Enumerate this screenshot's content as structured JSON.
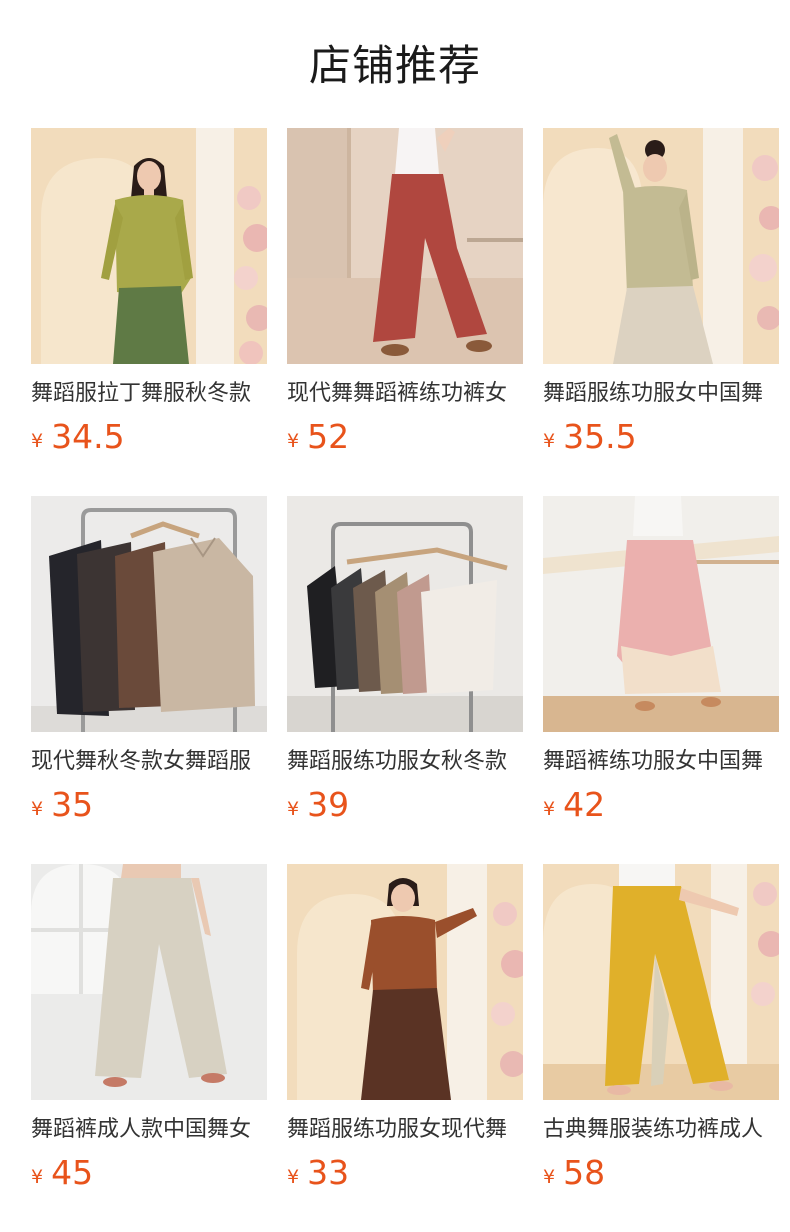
{
  "section": {
    "title": "店铺推荐"
  },
  "colors": {
    "price": "#e8531b",
    "text": "#333333"
  },
  "products": [
    {
      "name": "舞蹈服拉丁舞服秋冬款",
      "currency": "¥",
      "price": "34.5",
      "image": "olive-asymmetric-top-green-pants"
    },
    {
      "name": "现代舞舞蹈裤练功裤女",
      "currency": "¥",
      "price": "52",
      "image": "red-wide-leg-pants"
    },
    {
      "name": "舞蹈服练功服女中国舞",
      "currency": "¥",
      "price": "35.5",
      "image": "khaki-cardigan-beige-pants"
    },
    {
      "name": "现代舞秋冬款女舞蹈服",
      "currency": "¥",
      "price": "35",
      "image": "long-sleeve-tops-on-rack"
    },
    {
      "name": "舞蹈服练功服女秋冬款",
      "currency": "¥",
      "price": "39",
      "image": "camisoles-on-rack"
    },
    {
      "name": "舞蹈裤练功服女中国舞",
      "currency": "¥",
      "price": "42",
      "image": "pink-layered-skirt-pants"
    },
    {
      "name": "舞蹈裤成人款中国舞女",
      "currency": "¥",
      "price": "45",
      "image": "beige-wide-leg-pants"
    },
    {
      "name": "舞蹈服练功服女现代舞",
      "currency": "¥",
      "price": "33",
      "image": "brown-top-brown-pants"
    },
    {
      "name": "古典舞服装练功裤成人",
      "currency": "¥",
      "price": "58",
      "image": "yellow-wide-leg-pants"
    }
  ]
}
